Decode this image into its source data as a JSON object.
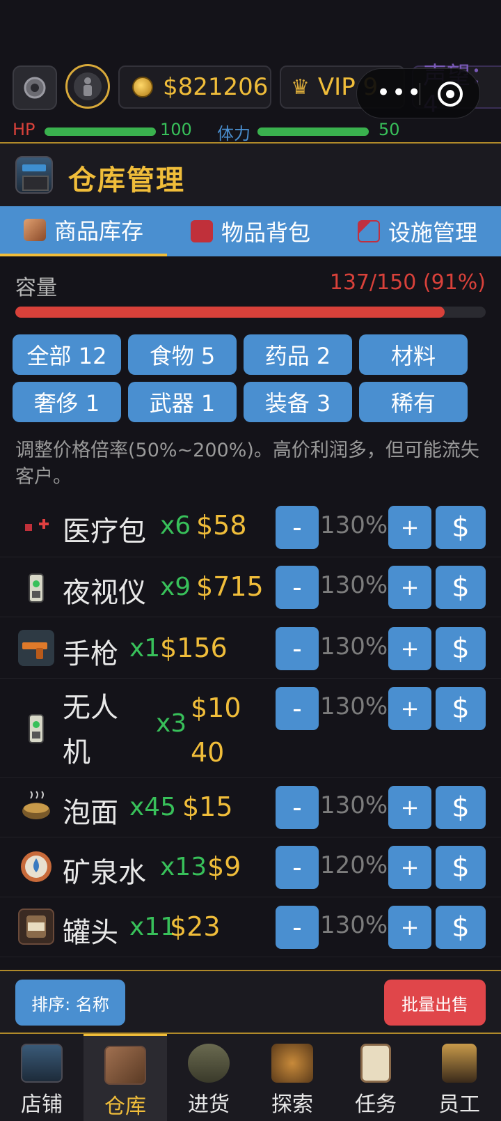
{
  "header": {
    "money": "$821206",
    "vip": "VIP 9",
    "reputation": "声望：4"
  },
  "stats": {
    "hp_label": "HP",
    "hp_value": "100",
    "hp_fraction": 1.0,
    "stamina_label": "体力",
    "stamina_value": "50",
    "stamina_fraction": 1.0
  },
  "page": {
    "title": "仓库管理"
  },
  "tabs": [
    {
      "label": "商品库存",
      "icon": "box-icon",
      "active": true
    },
    {
      "label": "物品背包",
      "icon": "backpack-icon",
      "active": false
    },
    {
      "label": "设施管理",
      "icon": "crane-icon",
      "active": false
    }
  ],
  "capacity": {
    "label": "容量",
    "value": "137/150 (91%)",
    "fraction": 0.913
  },
  "filters": [
    {
      "label": "全部 12"
    },
    {
      "label": "食物 5"
    },
    {
      "label": "药品 2"
    },
    {
      "label": "材料"
    },
    {
      "label": "奢侈 1"
    },
    {
      "label": "武器 1"
    },
    {
      "label": "装备 3"
    },
    {
      "label": "稀有"
    }
  ],
  "hint": "调整价格倍率(50%~200%)。高价利润多，但可能流失客户。",
  "items": [
    {
      "name": "医疗包",
      "qty": "x6",
      "price": "$58",
      "pct": "130%",
      "icon": "medkit-icon"
    },
    {
      "name": "夜视仪",
      "qty": "x9",
      "price": "$715",
      "pct": "130%",
      "icon": "night-vision-icon"
    },
    {
      "name": "手枪",
      "qty": "x1",
      "price": "$156",
      "pct": "130%",
      "icon": "pistol-icon"
    },
    {
      "name": "无人机",
      "qty": "x3",
      "price": "$1040",
      "pct": "130%",
      "icon": "drone-icon"
    },
    {
      "name": "泡面",
      "qty": "x45",
      "price": "$15",
      "pct": "130%",
      "icon": "noodles-icon"
    },
    {
      "name": "矿泉水",
      "qty": "x13",
      "price": "$9",
      "pct": "120%",
      "icon": "water-icon"
    },
    {
      "name": "罐头",
      "qty": "x11",
      "price": "$23",
      "pct": "130%",
      "icon": "canned-food-icon"
    }
  ],
  "buttons": {
    "minus": "-",
    "plus": "+",
    "sell": "$",
    "sort": "排序: 名称",
    "bulk_sell": "批量出售"
  },
  "nav": [
    {
      "label": "店铺",
      "icon": "shop-icon"
    },
    {
      "label": "仓库",
      "icon": "warehouse-icon",
      "active": true
    },
    {
      "label": "进货",
      "icon": "truck-icon"
    },
    {
      "label": "探索",
      "icon": "map-icon"
    },
    {
      "label": "任务",
      "icon": "clipboard-icon"
    },
    {
      "label": "员工",
      "icon": "team-icon"
    }
  ],
  "colors": {
    "accent_gold": "#f0bd3a",
    "primary_blue": "#4a8fd0",
    "danger_red": "#d8413a",
    "success_green": "#38c05a"
  }
}
